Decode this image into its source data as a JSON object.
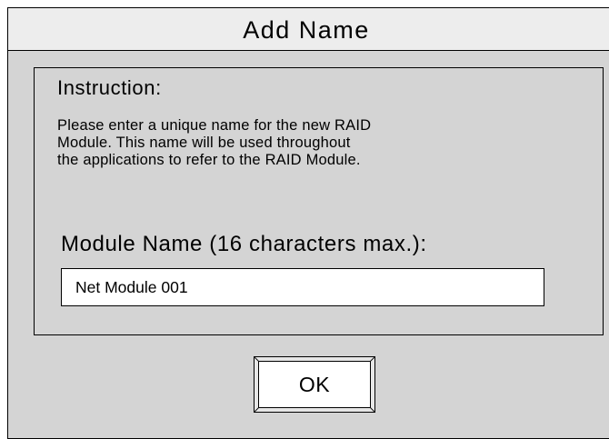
{
  "dialog": {
    "title": "Add Name"
  },
  "instruction": {
    "heading": "Instruction:",
    "lines": [
      "Please enter a unique name for the new RAID",
      "Module. This name will be used throughout",
      "the applications to refer to the RAID Module."
    ]
  },
  "module_name": {
    "label": "Module Name (16 characters max.):",
    "value": "Net Module 001"
  },
  "buttons": {
    "ok_label": "OK"
  }
}
